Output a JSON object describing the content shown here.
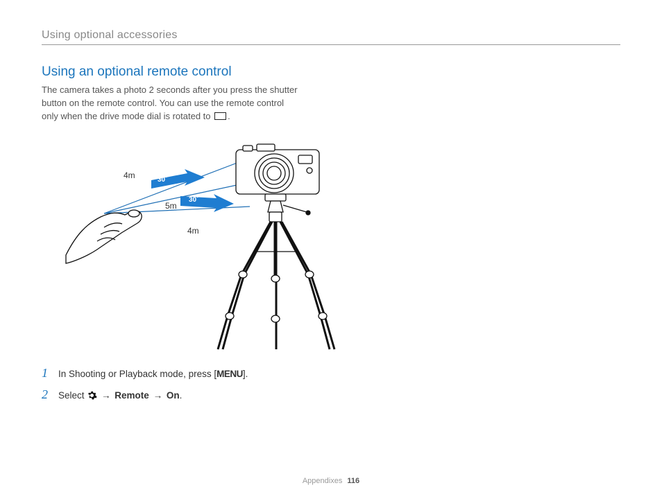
{
  "header": {
    "section": "Using optional accessories"
  },
  "title": "Using an optional remote control",
  "intro": {
    "line1": "The camera takes a photo 2 seconds after you press the shutter",
    "line2": "button on the remote control. You can use the remote control",
    "line3": "only when the drive mode dial is rotated to "
  },
  "diagram": {
    "dist_top": "4m",
    "dist_mid": "5m",
    "dist_bottom": "4m",
    "angle_top": "30˚",
    "angle_bottom": "30˚"
  },
  "steps": {
    "s1_num": "1",
    "s1_a": "In Shooting or Playback mode, press [",
    "s1_menu": "MENU",
    "s1_b": "].",
    "s2_num": "2",
    "s2_a": "Select ",
    "s2_arrow1": " → ",
    "s2_remote": "Remote",
    "s2_arrow2": " → ",
    "s2_on": "On",
    "s2_period": "."
  },
  "footer": {
    "section": "Appendixes",
    "page": "116"
  }
}
